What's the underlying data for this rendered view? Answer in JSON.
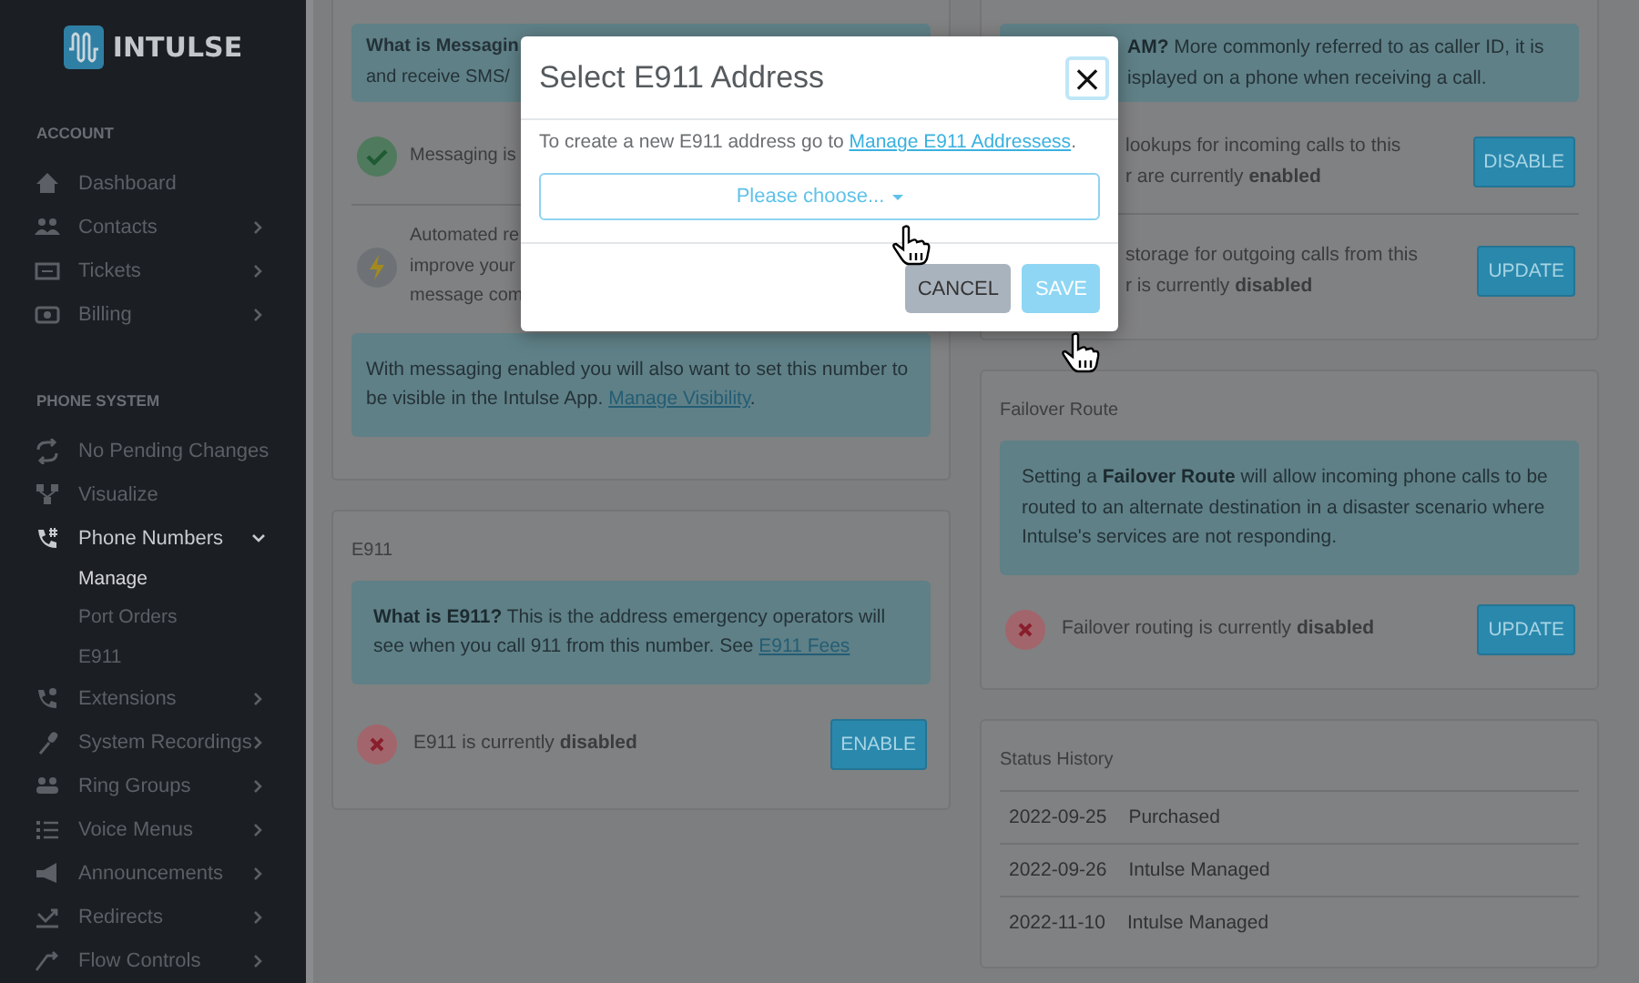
{
  "sidebar": {
    "logo": "INTULSE",
    "sections": [
      {
        "heading": "ACCOUNT",
        "items": [
          {
            "label": "Dashboard",
            "kind": "link",
            "selected": false
          },
          {
            "label": "Contacts",
            "kind": "menu",
            "expanded": false,
            "selected": false
          },
          {
            "label": "Tickets",
            "kind": "menu",
            "expanded": false,
            "selected": false
          },
          {
            "label": "Billing",
            "kind": "menu",
            "expanded": false,
            "selected": false
          }
        ]
      },
      {
        "heading": "PHONE SYSTEM",
        "items": [
          {
            "label": "No Pending Changes",
            "kind": "link",
            "selected": false
          },
          {
            "label": "Visualize",
            "kind": "link",
            "selected": false
          },
          {
            "label": "Phone Numbers",
            "kind": "menu",
            "expanded": true,
            "selected": true,
            "children": [
              {
                "label": "Manage",
                "selected": true
              },
              {
                "label": "Port Orders",
                "selected": false
              },
              {
                "label": "E911",
                "selected": false
              }
            ]
          },
          {
            "label": "Extensions",
            "kind": "menu",
            "expanded": false,
            "selected": false
          },
          {
            "label": "System Recordings",
            "kind": "menu",
            "expanded": false,
            "selected": false
          },
          {
            "label": "Ring Groups",
            "kind": "menu",
            "expanded": false,
            "selected": false
          },
          {
            "label": "Voice Menus",
            "kind": "menu",
            "expanded": false,
            "selected": false
          },
          {
            "label": "Announcements",
            "kind": "menu",
            "expanded": false,
            "selected": false
          },
          {
            "label": "Redirects",
            "kind": "menu",
            "expanded": false,
            "selected": false
          },
          {
            "label": "Flow Controls",
            "kind": "menu",
            "expanded": false,
            "selected": false
          }
        ]
      }
    ]
  },
  "columns": [
    [
      {
        "blocks": [
          {
            "kind": "info",
            "lines": [
              {
                "text": "What is Messagin",
                "bold": true
              },
              {
                "text": "and receive SMS/",
                "bold": false
              }
            ]
          },
          {
            "kind": "status",
            "icon": {
              "kind": "success"
            },
            "lines": [
              "Messaging is"
            ]
          },
          {
            "kind": "status",
            "icon": {
              "kind": "auto"
            },
            "lines": [
              "Automated re",
              "improve your",
              "message com"
            ]
          },
          {
            "kind": "info",
            "text": "With messaging enabled you will also want to set this number to be visible in the Intulse App. ",
            "link": "Manage Visibility",
            "after": "."
          }
        ]
      },
      {
        "title": "E911",
        "blocks": [
          {
            "kind": "info",
            "text": "**What is E911?** This is the address emergency operators will see when you call 911 from this number. See ",
            "link": "E911 Fees"
          },
          {
            "kind": "status",
            "icon": {
              "kind": "error"
            },
            "lines": [
              "E911 is currently **disabled**"
            ],
            "button": "ENABLE"
          }
        ]
      }
    ],
    [
      {
        "blocks": [
          {
            "kind": "info",
            "lines": [
              {
                "text": "**AM?** More commonly referred to as caller ID, it is",
                "bold": false
              },
              {
                "text": "isplayed on a phone when receiving a call.",
                "bold": false
              }
            ]
          },
          {
            "kind": "status",
            "lines": [
              "lookups for incoming calls to this",
              "r are currently **enabled**"
            ],
            "button": "DISABLE"
          },
          {
            "kind": "status",
            "lines": [
              "storage for outgoing calls from this",
              "r is currently **disabled**"
            ],
            "button": "UPDATE"
          }
        ]
      },
      {
        "title": "Failover Route",
        "blocks": [
          {
            "kind": "info",
            "text": "Setting a **Failover Route** will allow incoming phone calls to be routed to an alternate destination in a disaster scenario where Intulse's services are not responding."
          },
          {
            "kind": "status",
            "icon": {
              "kind": "error"
            },
            "lines": [
              "Failover routing is currently **disabled**"
            ],
            "button": "UPDATE"
          }
        ]
      },
      {
        "title": "Status History",
        "blocks": [
          {
            "kind": "table",
            "rows": [
              {
                "date": "2022-09-25",
                "event": "Purchased"
              },
              {
                "date": "2022-09-26",
                "event": "Intulse Managed"
              },
              {
                "date": "2022-11-10",
                "event": "Intulse Managed"
              }
            ]
          }
        ]
      }
    ]
  ],
  "modal": {
    "title": "Select E911 Address",
    "close": "×",
    "text": "To create a new E911 address go to ",
    "link": "Manage E911 Addressess",
    "after": ".",
    "select": {
      "placeholder": "Please choose..."
    },
    "buttons": [
      {
        "label": "CANCEL",
        "kind": "secondary",
        "disabled": false
      },
      {
        "label": "SAVE",
        "kind": "primary",
        "disabled": true
      }
    ]
  }
}
